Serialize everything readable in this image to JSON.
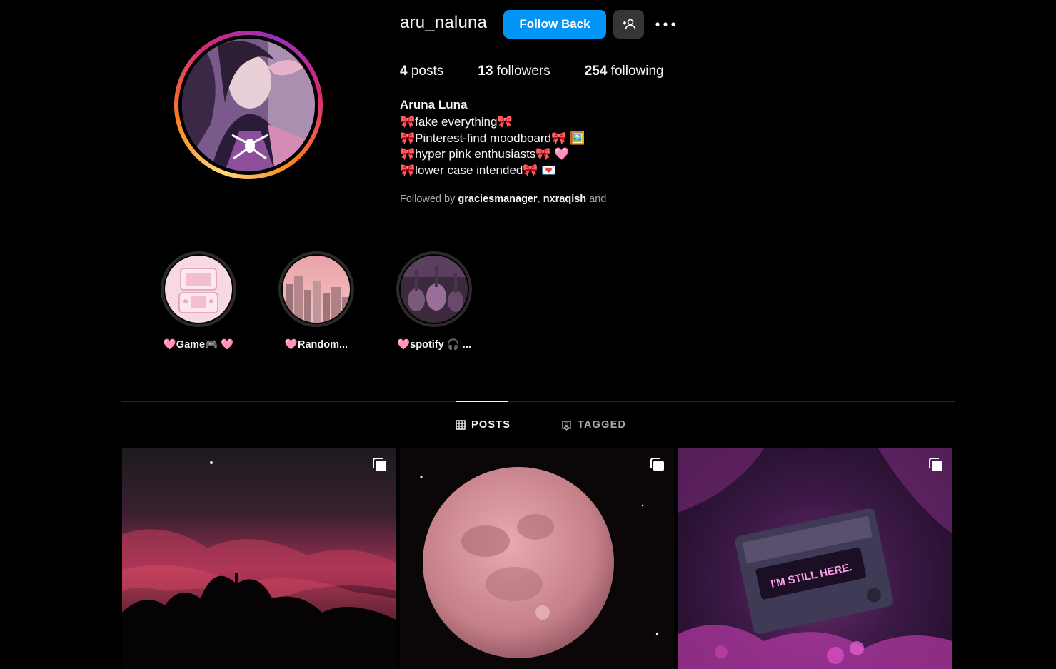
{
  "profile": {
    "username": "aru_naluna",
    "follow_label": "Follow Back",
    "full_name": "Aruna Luna",
    "stats": {
      "posts_count": "4",
      "posts_label": "posts",
      "followers_count": "13",
      "followers_label": "followers",
      "following_count": "254",
      "following_label": "following"
    },
    "bio_lines": [
      "🎀fake everything🎀",
      "🎀Pinterest-find moodboard🎀  🖼️",
      "🎀hyper pink enthusiasts🎀  🩷",
      "🎀lower case intended🎀 💌"
    ],
    "followed_by": {
      "prefix": "Followed by ",
      "user1": "graciesmanager",
      "separator": ", ",
      "user2": "nxraqish",
      "suffix": " and"
    }
  },
  "highlights": [
    {
      "label": "🩷Game🎮 🩷",
      "icon": "game-console"
    },
    {
      "label": "🩷Random...",
      "icon": "city-skyline"
    },
    {
      "label": "🩷spotify 🎧 ...",
      "icon": "guitars"
    }
  ],
  "tabs": [
    {
      "label": "POSTS",
      "icon": "grid-icon",
      "active": true
    },
    {
      "label": "TAGGED",
      "icon": "tagged-icon",
      "active": false
    }
  ],
  "posts": [
    {
      "kind": "carousel",
      "subject": "pink sunset trees"
    },
    {
      "kind": "carousel",
      "subject": "pink full moon"
    },
    {
      "kind": "carousel",
      "subject": "retro tv",
      "sign_text": "I'M STILL HERE."
    }
  ],
  "colors": {
    "accent": "#0095f6",
    "background": "#000000",
    "secondary_button": "#363636",
    "muted_text": "#a8a8a8"
  }
}
